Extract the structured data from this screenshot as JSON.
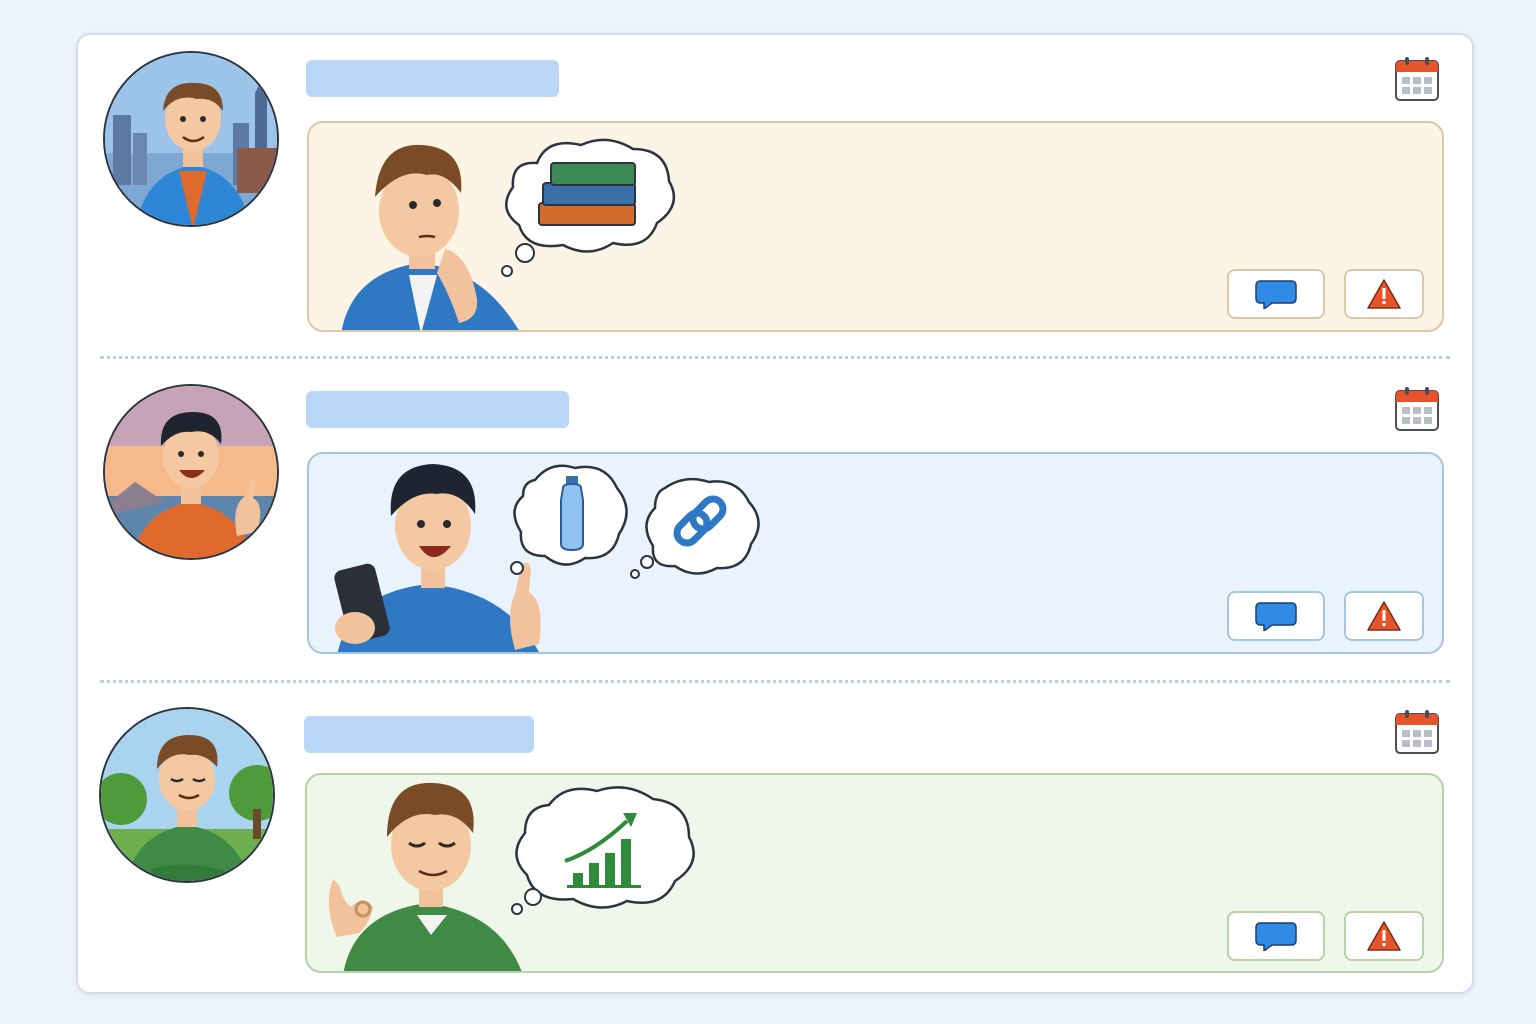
{
  "colors": {
    "page_background": "#eef4fb",
    "name_placeholder": "#bad7f7",
    "card_1_background": "#fdf4e5",
    "card_2_background": "#e9f3fd",
    "card_3_background": "#eef7ea",
    "comment_icon": "#2f8be6",
    "report_icon": "#e8542a",
    "calendar_header": "#e8542a"
  },
  "posts": [
    {
      "avatar_icon": "man-blue-hoodie-city-avatar",
      "scene_icons": [
        "thinking-man-icon",
        "books-thought-icon"
      ],
      "actions": [
        "comment-icon",
        "report-warning-icon"
      ],
      "date_icon": "calendar-icon"
    },
    {
      "avatar_icon": "man-orange-shirt-sunset-avatar",
      "scene_icons": [
        "man-with-phone-thumbs-up-icon",
        "water-bottle-thought-icon",
        "link-thought-icon"
      ],
      "actions": [
        "comment-icon",
        "report-warning-icon"
      ],
      "date_icon": "calendar-icon"
    },
    {
      "avatar_icon": "man-green-hoodie-park-avatar",
      "scene_icons": [
        "content-man-ok-gesture-icon",
        "growth-chart-thought-icon"
      ],
      "actions": [
        "comment-icon",
        "report-warning-icon"
      ],
      "date_icon": "calendar-icon"
    }
  ]
}
